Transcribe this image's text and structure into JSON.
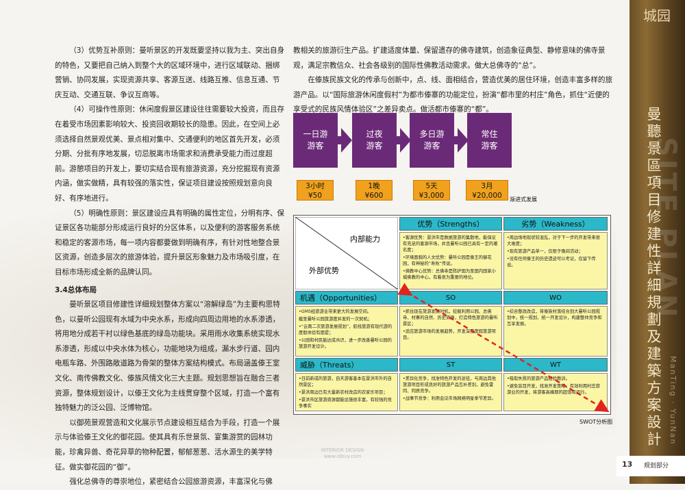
{
  "left_column": {
    "paragraphs": [
      "（3）优势互补原则：曼听景区的开发既要坚持以我为主、突出自身的特色，又要把自己纳入到整个大的区域环境中，进行区域联动、捆绑营销、协同发展，实现资源共享、客源互送、线路互推、信息互通、节庆互动、交通互联、争议互商等。",
      "（4）可操作性原则：休闲度假景区建设往往需要较大投资，而且存在着受市场因素影响较大、投资回收期较长的隐患。因此，在空间上必须选择自然景观优美、景点相对集中、交通便利的地区首先开发，必须分期、分批有序地发展，切忌脱离市场需求和消费承受能力而过度超前。游憩项目的开发上，要切实结合现有旅游资源，充分挖掘现有资源内涵，做实做精，具有较强的落实性，保证项目建设按照规划意向良好、有序地进行。",
      "（5）明确性原则：景区建设应具有明确的属性定位，分明有序、保证景区各功能部分形成运行良好的分区体系，以及便利的游客服务系统和稳定的客源市场，每一项内容都要做到明确有序，有针对性地整合景区资源，创造多层次的旅游体验，提升景区形象魅力及市场吸引度，在目标市场形成全新的品牌认同。"
    ],
    "section_title": "3.4总体布局",
    "section_paragraphs": [
      "曼听景区项目修建性详细规划整体方案以“溶解绿岛”为主要构思特色，以曼听公园现有水域为中央水系，形成向四周边用地的水系渗透，将用地分成若干衬以绿色基底的绿岛功能块。采用雨水收集系统实现水系渗透，形成以中央水体为核心，功能地块为组成，漏水步行道、园内电瓶车路、外围路敞道路为骨架的整体方案结构模式。布局涵盖傣王室文化、南传佛教文化、傣族风情文化三大主题。规划思想旨在融合三者资源，整体规划设计，以傣王文化为主线贯穿整个区域，打造一个富有独特魅力的泛公园、泛博物馆。",
      "以御苑景观营造和文化展示节点建设相互结合为手段，打造一个展示与体验傣王文化的御花园。使其具有乐世景氛、宴集游赏的园林功能，珍禽异兽、奇花异草的物种配置，郁郁葱葱、活水源生的美学特征。做实御花园的“御”。",
      "强化总佛寺的尊崇地位，紧密结合公园旅游资源，丰富深化与佛"
    ]
  },
  "right_column": {
    "paragraphs": [
      "教相关的旅游衍生产品。扩建适度体量、保留遗存的佛寺建筑，创造象征典型、静修意味的佛寺景观，满足宗教信众、社会各级别的国际性佛教活动需求。做大总佛寺的“总”。",
      "在傣族民族文化的传承与创新中，点、线、面相结合，营造优美的居住环境，创造丰富多样的旅游产品。以“国际旅游休闲度假村”为都市傣寨的功能定位，扮演“都市里的村庄”角色，抓住“近便的享受式的民族风情体验区”之差异卖点。做活都市傣寨的“都”。"
    ]
  },
  "flow": {
    "caption": "渐进式发展",
    "steps": [
      {
        "label1": "一日游",
        "label2": "游客",
        "value1": "3小时",
        "value2": "¥50"
      },
      {
        "label1": "过夜",
        "label2": "游客",
        "value1": "1晚",
        "value2": "¥600"
      },
      {
        "label1": "多日游",
        "label2": "游客",
        "value1": "5天",
        "value2": "¥3,000"
      },
      {
        "label1": "常住",
        "label2": "游客",
        "value1": "3月",
        "value2": "¥20,000"
      }
    ],
    "colors": {
      "box": "#6b2a78",
      "value": "#f0a21e"
    }
  },
  "swot": {
    "caption": "SWOT分析图",
    "corner_top": "内部能力",
    "corner_bottom": "外部优势",
    "strengths_title": "优势（Strengths）",
    "weakness_title": "劣势（Weakness）",
    "opportunities_title": "机遇（Opportunities）",
    "threats_title": "威胁（Threats）",
    "so": "SO",
    "wo": "WO",
    "st": "ST",
    "wt": "WT",
    "strengths_items": [
      "•客源优势：景洪市是数据旅游的集散地，能保证有充足的客源市场，并且曼听公园已具有一定的著名度；",
      "•环境面貌的人文优势：曼听公园是傣王的御花园，有神秘的“寿秋”传说。",
      "•佛教中心优势：总佛寺是陈护国为至国内国家小城佛教的中心，有着很为重要的地位。"
    ],
    "weakness_items": [
      "•周边场地现状较混乱，对于下一步的开发带来很大难度；",
      "•现有旅游产品单一，仅限于晚间活动；",
      "•没有任何傣王的历史遗迹可以考证，仅留下传说。"
    ],
    "opportunities_items": [
      "•GMS经旅游业带来更大的发展空间。",
      "截至曼听公园旅游度并发的一次契机；",
      "•“云南二次旅游发展规划”，航线旅游有现代游的度假体验有度提；",
      "•公园和村民能达成共识，进一步改善曼听公园的旅游开发设计。"
    ],
    "so_items": [
      "•抓住现在旅游发展时机，挖掘利用公园、总佛寺、村寨的自然、历史资源，打造特色旅游的曼听景区；",
      "•适应旅游市场的发展趋势，开发深度度假旅游项目。"
    ],
    "wo_items": [
      "•综合整改改造，将傣族村落结合到大曼听公园规划中，统一规划、统一开发设计，构建整体竞争和互享发展。"
    ],
    "threats_items": [
      "•日前新成的旅游，自天游客基本在景洪市外的自然景区；",
      "•景洪周边已有大量新农村改造的农家乐项目；",
      "•景洪市区旅游资源都能设施很丰富，有较强的竞争事实"
    ],
    "st_items": [
      "•差异化竞争，找准特色开发的途径，与周边其他旅游项目形成良好的旅游产品互补差别，避免雷同、同质竞争。",
      "•战事节竞争：利用会议市场网络明星季节差异。"
    ],
    "wt_items": [
      "•吸取失败的旅游产品经验教训。",
      "•避免盲目开发，找准开发策略，有效利用村庄旅游业的开发，将游客高峰期的超饱和运行。"
    ],
    "colors": {
      "header": "#2bb8c8",
      "cell": "#fbf6a6",
      "arrow": "#e0241e"
    }
  },
  "sidebar": {
    "logo_text": "城园",
    "title": "曼聽景區項目修建性詳細規劃及建築方案設計",
    "bg_text": "SITE PLAN",
    "sub_text": "ManTing · YunNan"
  },
  "footer": {
    "page_number": "13",
    "section": "规划部分"
  },
  "watermark": {
    "line1": "INTERIOR DESIGN",
    "line2": "www.idbuy.com"
  }
}
